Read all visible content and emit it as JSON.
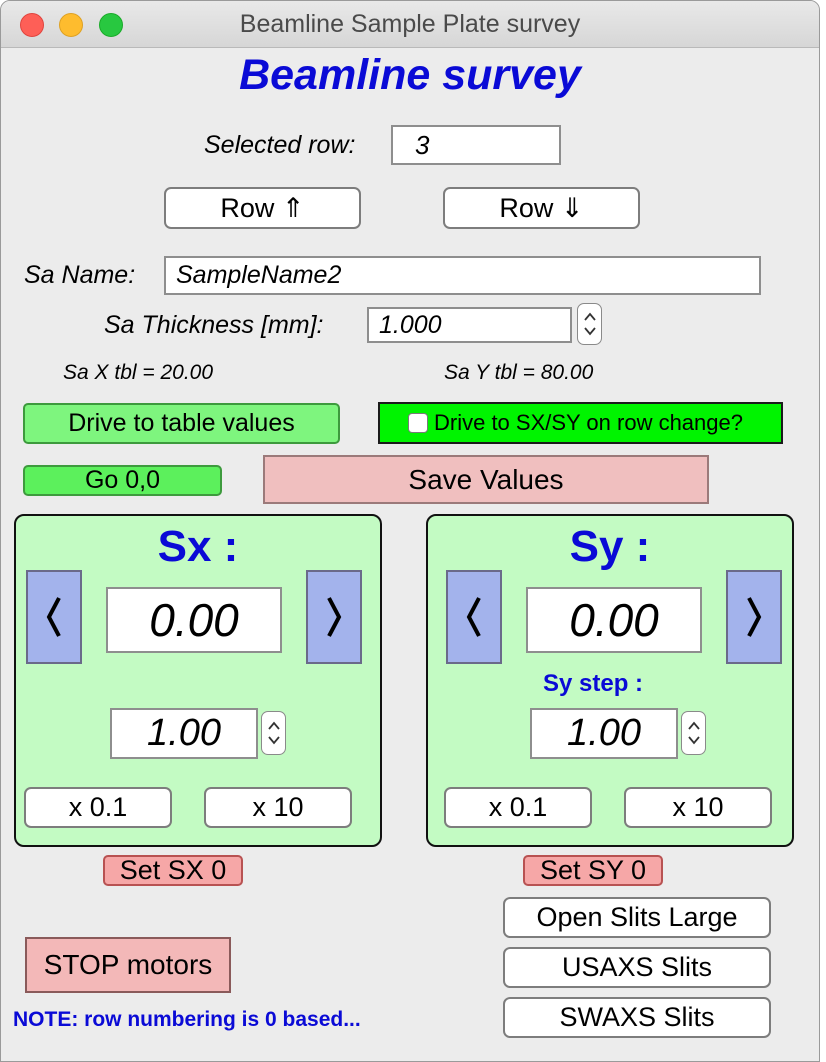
{
  "window": {
    "title": "Beamline Sample Plate survey"
  },
  "heading": "Beamline survey",
  "selected_row": {
    "label": "Selected row:",
    "value": "3"
  },
  "row_up_label": "Row ⇑",
  "row_down_label": "Row ⇓",
  "sample_name": {
    "label": "Sa Name:",
    "value": "SampleName2"
  },
  "sample_thickness": {
    "label": "Sa Thickness [mm]:",
    "value": "1.000"
  },
  "sa_x_tbl": "Sa X tbl =  20.00",
  "sa_y_tbl": "Sa Y tbl =  80.00",
  "drive_table_label": "Drive to table values",
  "drive_on_row_change_label": "Drive to SX/SY on row change?",
  "drive_on_row_change_checked": false,
  "go00_label": "Go 0,0",
  "save_values_label": "Save Values",
  "sx": {
    "title": "Sx :",
    "value": "0.00",
    "step": "1.00",
    "x01_label": "x 0.1",
    "x10_label": "x 10",
    "set_zero_label": "Set SX 0"
  },
  "sy": {
    "title": "Sy :",
    "value": "0.00",
    "step_label": "Sy step :",
    "step": "1.00",
    "x01_label": "x 0.1",
    "x10_label": "x 10",
    "set_zero_label": "Set SY 0"
  },
  "open_slits_large_label": "Open Slits Large",
  "usaxs_slits_label": "USAXS Slits",
  "swaxs_slits_label": "SWAXS Slits",
  "stop_motors_label": "STOP motors",
  "note": "NOTE: row numbering is 0 based...",
  "colors": {
    "heading_blue": "#0a0ad6",
    "green_button": "#7ef57e",
    "bright_green": "#00f400",
    "pink_button": "#f0bfbf",
    "panel_green": "#c3fbc3",
    "arrow_blue": "#a3b3ec"
  }
}
